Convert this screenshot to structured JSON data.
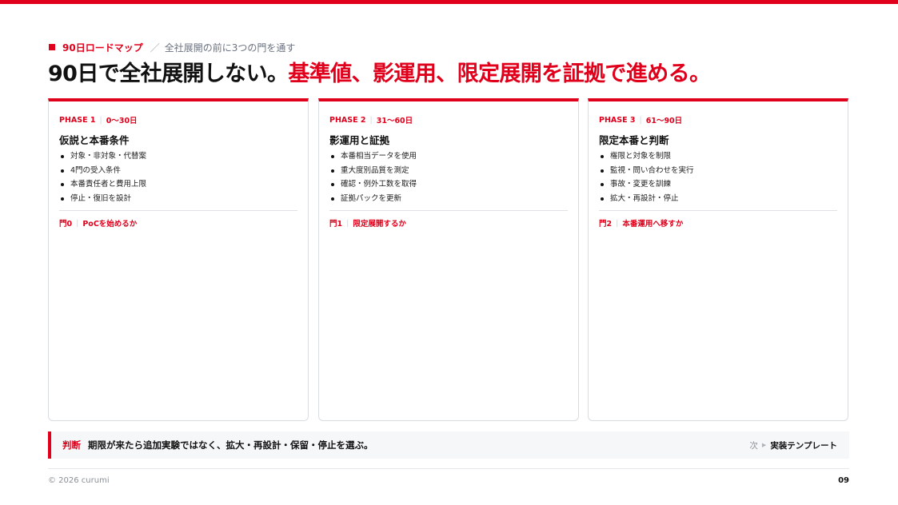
{
  "header": {
    "section": "90日ロードマップ",
    "subtitle": "全社展開の前に3つの門を通す",
    "headline_black": "90日で全社展開しない。",
    "headline_red": "基準値、影運用、限定展開を証拠で進める。"
  },
  "phases": [
    {
      "phase": "PHASE 1",
      "range": "0〜30日",
      "title": "仮説と本番条件",
      "items": [
        "対象・非対象・代替案",
        "4門の受入条件",
        "本番責任者と費用上限",
        "停止・復旧を設計"
      ],
      "gate": "門0",
      "gate_text": "PoCを始めるか"
    },
    {
      "phase": "PHASE 2",
      "range": "31〜60日",
      "title": "影運用と証拠",
      "items": [
        "本番相当データを使用",
        "重大度別品質を測定",
        "確認・例外工数を取得",
        "証拠パックを更新"
      ],
      "gate": "門1",
      "gate_text": "限定展開するか"
    },
    {
      "phase": "PHASE 3",
      "range": "61〜90日",
      "title": "限定本番と判断",
      "items": [
        "権限と対象を制限",
        "監視・問い合わせを実行",
        "事故・変更を訓練",
        "拡大・再設計・停止"
      ],
      "gate": "門2",
      "gate_text": "本番運用へ移すか"
    }
  ],
  "judgement": {
    "label": "判断",
    "text": "期限が来たら追加実験ではなく、拡大・再設計・保留・停止を選ぶ。",
    "next_label": "次",
    "next_value": "実装テンプレート"
  },
  "footer": {
    "copyright": "© 2026 curumi",
    "page": "09"
  },
  "colors": {
    "accent": "#e0001b",
    "text": "#111111",
    "muted": "#6b7280",
    "panel": "#f6f7f9"
  }
}
